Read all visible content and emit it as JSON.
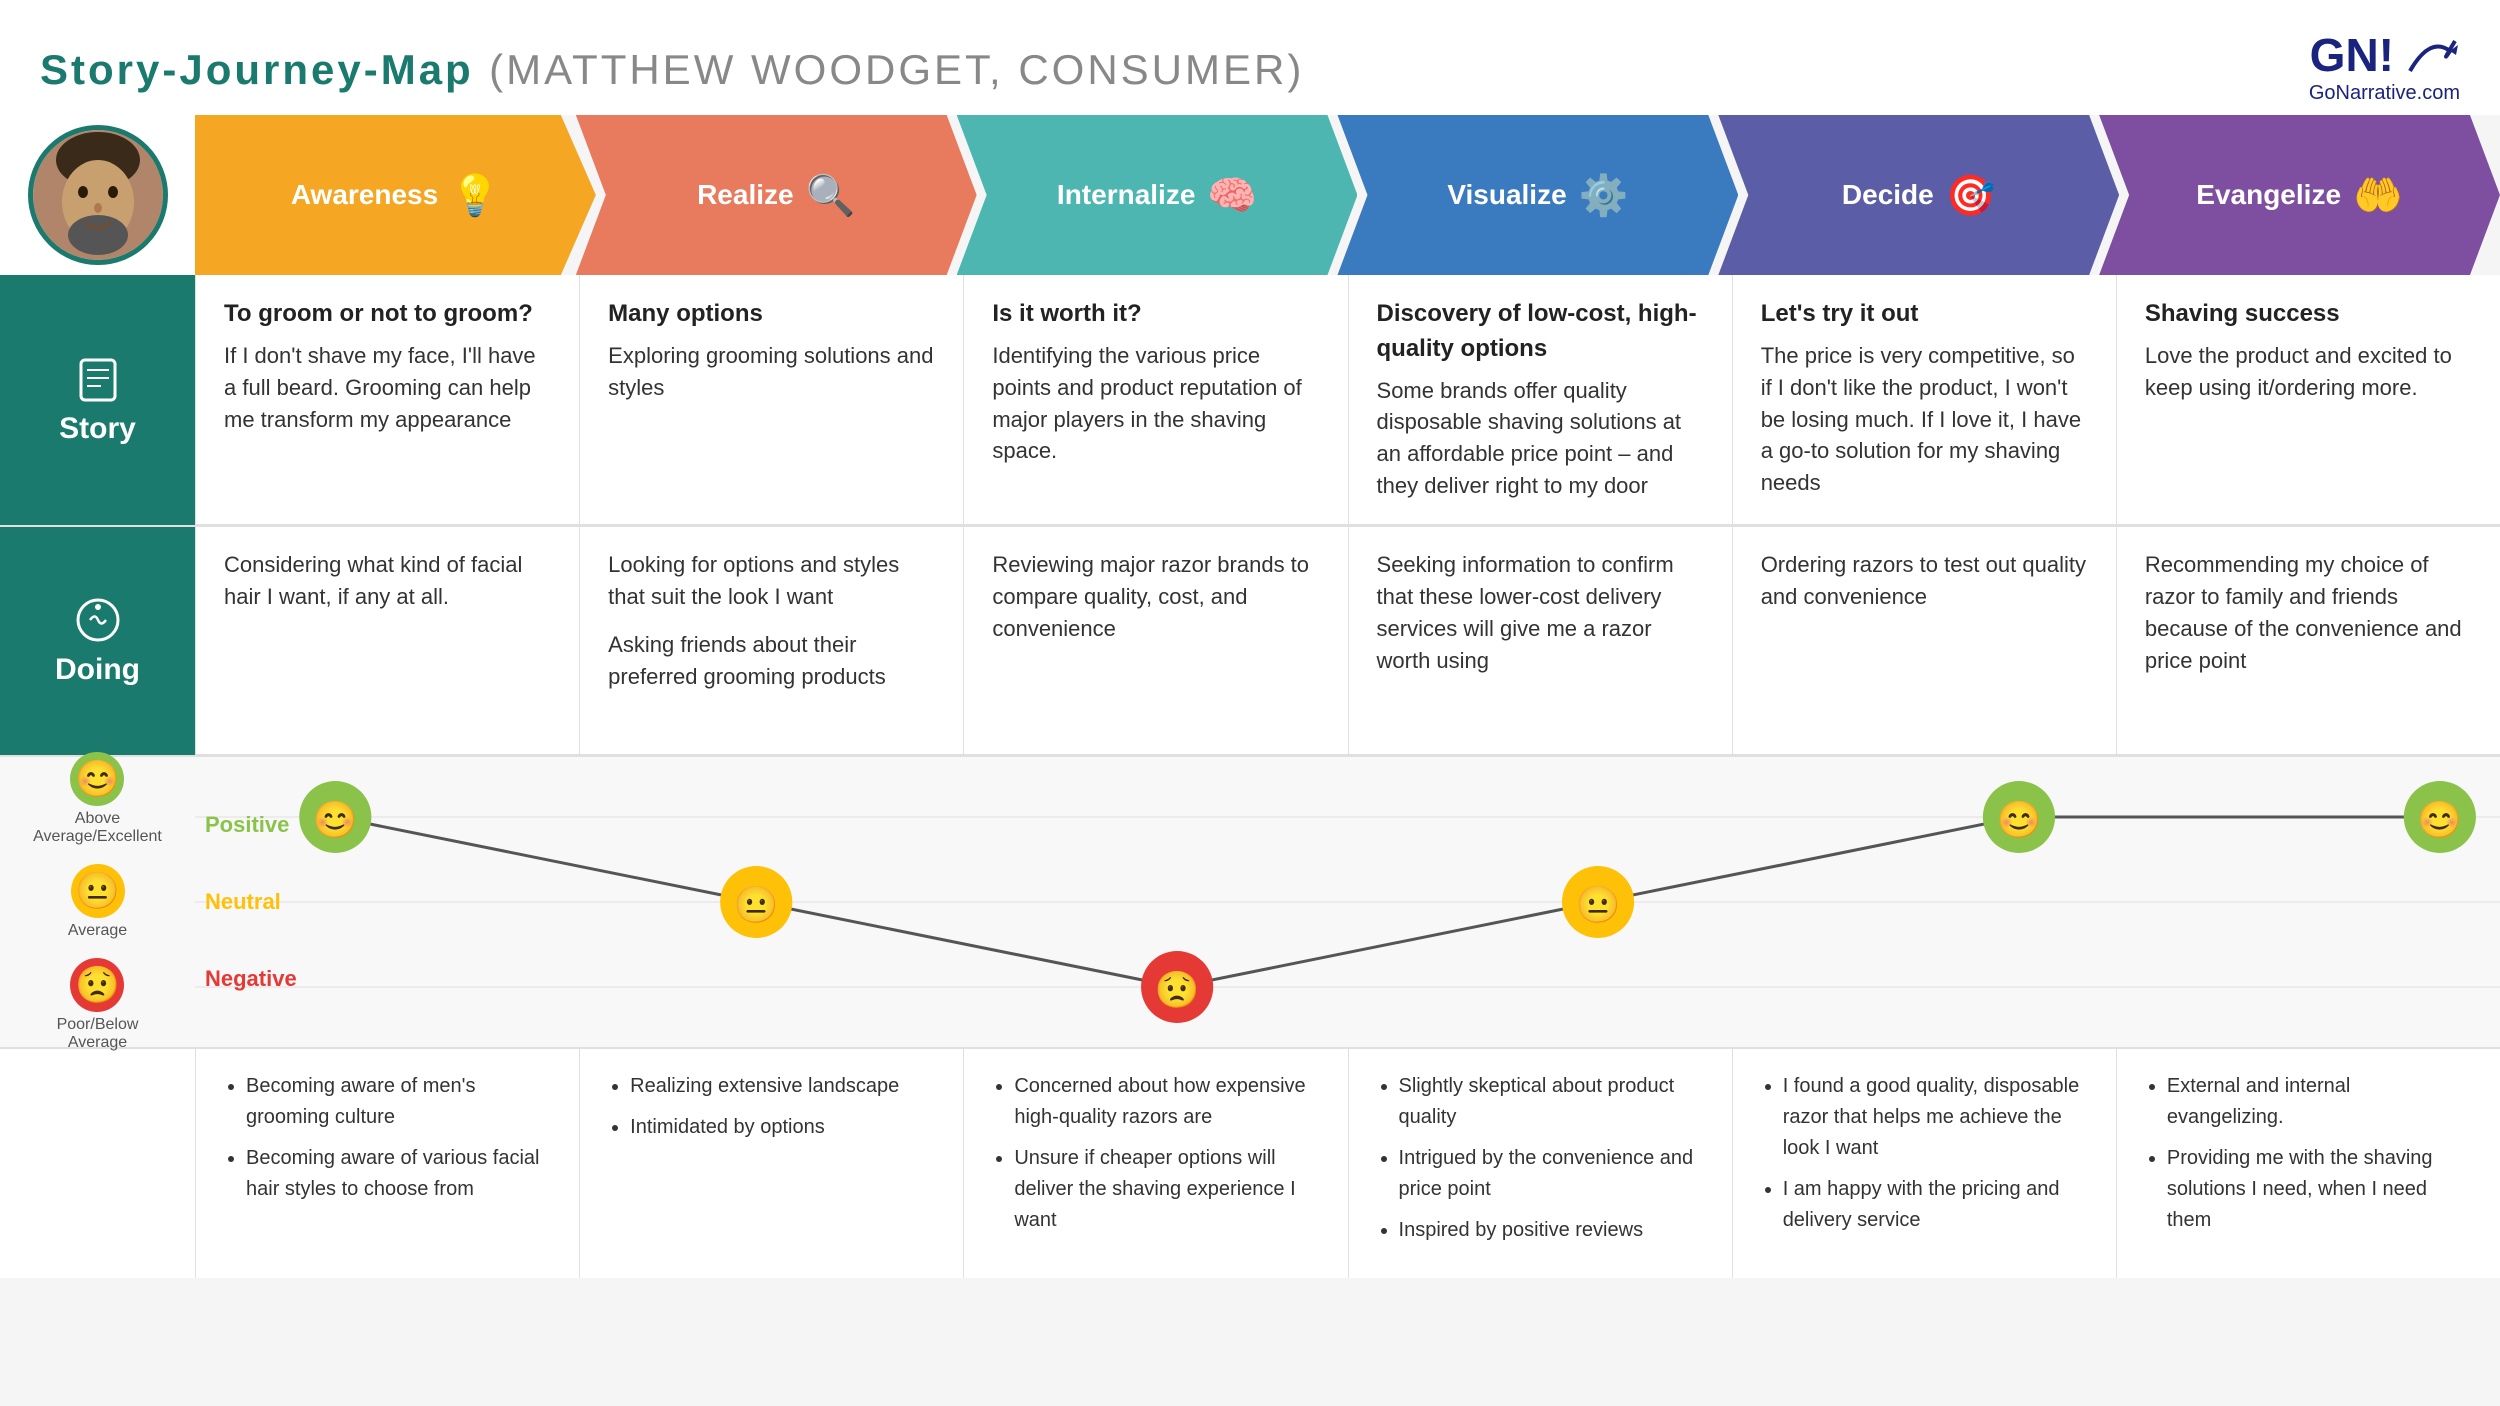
{
  "header": {
    "title": "Story-Journey-Map",
    "subtitle": "(MATTHEW WOODGET, CONSUMER)",
    "logo_text": "GN!",
    "logo_sub": "GoNarrative.com"
  },
  "stages": [
    {
      "id": "awareness",
      "label": "Awareness",
      "color": "#f5a623",
      "icon": "💡"
    },
    {
      "id": "realize",
      "label": "Realize",
      "color": "#e87a5d",
      "icon": "🔍"
    },
    {
      "id": "internalize",
      "label": "Internalize",
      "color": "#4db6b0",
      "icon": "🧠"
    },
    {
      "id": "visualize",
      "label": "Visualize",
      "color": "#3a7abf",
      "icon": "⚙️"
    },
    {
      "id": "decide",
      "label": "Decide",
      "color": "#5b5ea6",
      "icon": "🎯"
    },
    {
      "id": "evangelize",
      "label": "Evangelize",
      "color": "#7e4fa0",
      "icon": "🤲"
    }
  ],
  "story_row": {
    "label": "Story",
    "cells": [
      {
        "title": "To groom or not to groom?",
        "text": "If I don't shave my face, I'll have a full beard. Grooming can help me transform my appearance"
      },
      {
        "title": "Many options",
        "text": "Exploring grooming solutions and styles"
      },
      {
        "title": "Is it worth it?",
        "text": "Identifying the various price points and product reputation of major players in the shaving space."
      },
      {
        "title": "Discovery of low-cost, high-quality options",
        "text": "Some brands offer quality disposable shaving solutions at an affordable price point – and they deliver right to my door"
      },
      {
        "title": "Let's try it out",
        "text": "The price is very competitive, so if I don't like the product, I won't be losing much. If I love it, I have a go-to solution for my shaving needs"
      },
      {
        "title": "Shaving success",
        "text": "Love the product and excited to keep using it/ordering more."
      }
    ]
  },
  "doing_row": {
    "label": "Doing",
    "cells": [
      {
        "items": [
          "Considering what kind of facial hair I want, if any at all."
        ]
      },
      {
        "items": [
          "Looking for options and styles that suit the look I want",
          "Asking friends about their preferred grooming products"
        ]
      },
      {
        "items": [
          "Reviewing major razor brands to compare quality, cost, and convenience"
        ]
      },
      {
        "items": [
          "Seeking information to confirm that these lower-cost delivery services will give me a razor worth using"
        ]
      },
      {
        "items": [
          "Ordering razors to test out quality and convenience"
        ]
      },
      {
        "items": [
          "Recommending my choice of razor to family and friends because of the convenience and price point"
        ]
      }
    ]
  },
  "emotions": {
    "legend": [
      {
        "type": "positive",
        "face": "😊",
        "label": "Above\nAverage/Excellent"
      },
      {
        "type": "neutral",
        "face": "😐",
        "label": "Average"
      },
      {
        "type": "negative",
        "face": "😟",
        "label": "Poor/Below\nAverage"
      }
    ],
    "labels": [
      "Positive",
      "Neutral",
      "Negative"
    ],
    "points": [
      {
        "stage": 0,
        "level": "positive"
      },
      {
        "stage": 1,
        "level": "neutral"
      },
      {
        "stage": 2,
        "level": "negative"
      },
      {
        "stage": 3,
        "level": "neutral"
      },
      {
        "stage": 4,
        "level": "positive"
      },
      {
        "stage": 5,
        "level": "positive"
      }
    ]
  },
  "bullets_row": {
    "cells": [
      {
        "items": [
          "Becoming aware of men's grooming culture",
          "Becoming aware of various facial hair styles to choose from"
        ]
      },
      {
        "items": [
          "Realizing extensive landscape",
          "Intimidated by options"
        ]
      },
      {
        "items": [
          "Concerned about how expensive high-quality razors are",
          "Unsure if cheaper options will deliver the shaving experience I want"
        ]
      },
      {
        "items": [
          "Slightly skeptical about product quality",
          "Intrigued by the convenience and price point",
          "Inspired by positive reviews"
        ]
      },
      {
        "items": [
          "I found a good quality, disposable razor that helps me achieve the look I want",
          "I am happy with the pricing and delivery service"
        ]
      },
      {
        "items": [
          "External and internal evangelizing.",
          "Providing me with the shaving solutions I need, when I need them"
        ]
      }
    ]
  }
}
